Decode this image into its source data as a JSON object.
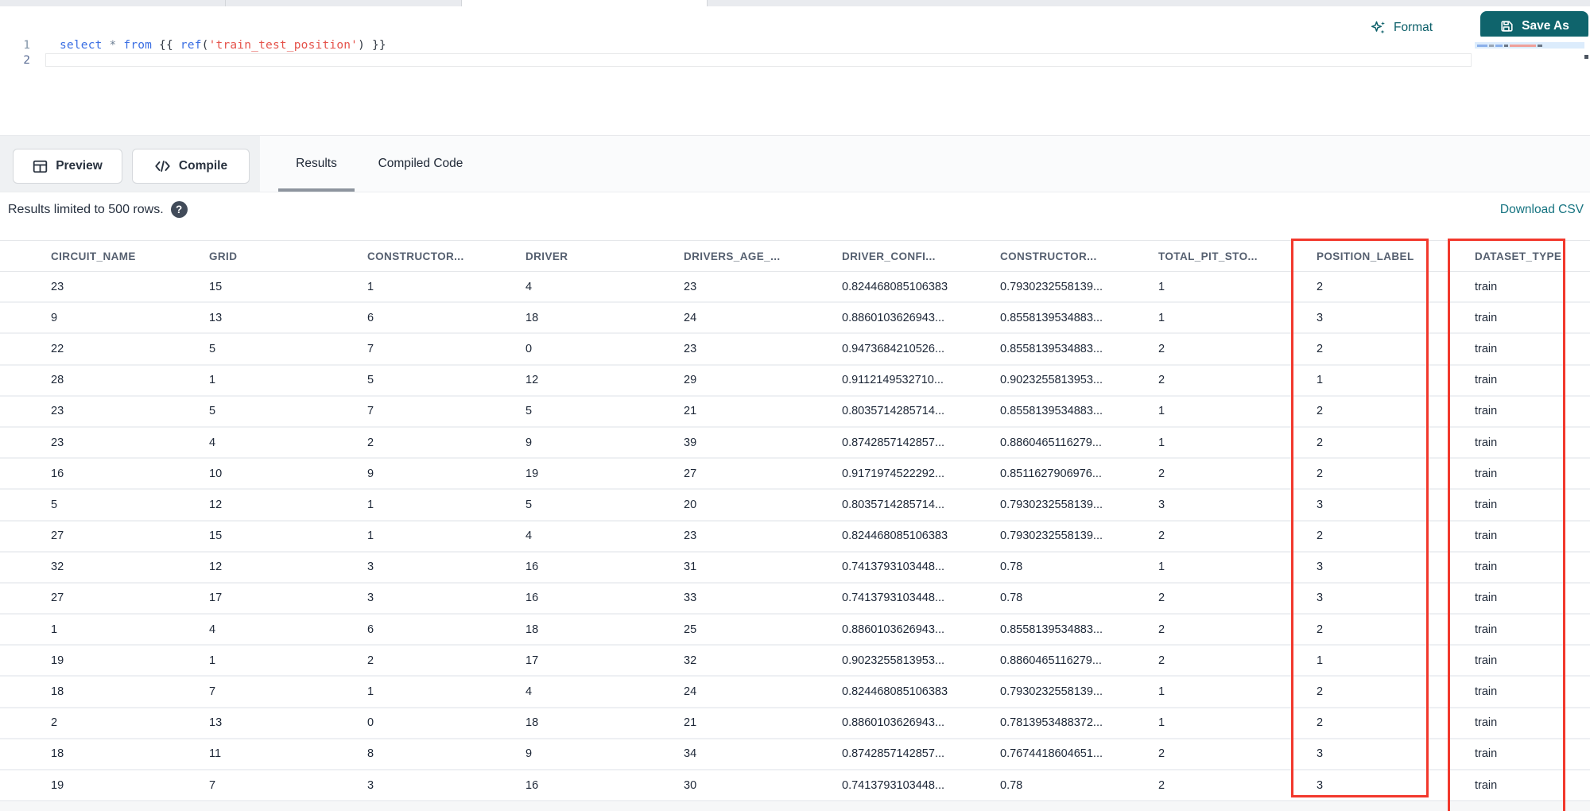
{
  "colors": {
    "accent": "#0f646c",
    "highlight_box": "#f2382c",
    "keyword_blue": "#3b6fe3",
    "string_red": "#e5534b"
  },
  "toolbar": {
    "format_label": "Format",
    "save_as_label": "Save As"
  },
  "editor": {
    "line1_number": "1",
    "line2_number": "2",
    "code_tokens": [
      {
        "text": "select ",
        "color": "#3b6fe3"
      },
      {
        "text": "* ",
        "color": "#6d7f94"
      },
      {
        "text": "from ",
        "color": "#3b6fe3"
      },
      {
        "text": "{{ ",
        "color": "#333a45"
      },
      {
        "text": "ref",
        "color": "#3b6fe3"
      },
      {
        "text": "(",
        "color": "#333a45"
      },
      {
        "text": "'train_test_position'",
        "color": "#e5534b"
      },
      {
        "text": ")",
        "color": "#333a45"
      },
      {
        "text": " }}",
        "color": "#333a45"
      }
    ]
  },
  "actions": {
    "preview_label": "Preview",
    "compile_label": "Compile"
  },
  "tabs": {
    "results": "Results",
    "compiled_code": "Compiled Code"
  },
  "results_bar": {
    "limit_text": "Results limited to 500 rows.",
    "help_icon": "?",
    "download_label": "Download CSV"
  },
  "table": {
    "columns": [
      "CIRCUIT_NAME",
      "GRID",
      "CONSTRUCTOR...",
      "DRIVER",
      "DRIVERS_AGE_...",
      "DRIVER_CONFI...",
      "CONSTRUCTOR...",
      "TOTAL_PIT_STO...",
      "POSITION_LABEL",
      "DATASET_TYPE"
    ],
    "rows": [
      [
        "23",
        "15",
        "1",
        "4",
        "23",
        "0.824468085106383",
        "0.7930232558139...",
        "1",
        "2",
        "train"
      ],
      [
        "9",
        "13",
        "6",
        "18",
        "24",
        "0.8860103626943...",
        "0.8558139534883...",
        "1",
        "3",
        "train"
      ],
      [
        "22",
        "5",
        "7",
        "0",
        "23",
        "0.9473684210526...",
        "0.8558139534883...",
        "2",
        "2",
        "train"
      ],
      [
        "28",
        "1",
        "5",
        "12",
        "29",
        "0.9112149532710...",
        "0.9023255813953...",
        "2",
        "1",
        "train"
      ],
      [
        "23",
        "5",
        "7",
        "5",
        "21",
        "0.8035714285714...",
        "0.8558139534883...",
        "1",
        "2",
        "train"
      ],
      [
        "23",
        "4",
        "2",
        "9",
        "39",
        "0.8742857142857...",
        "0.8860465116279...",
        "1",
        "2",
        "train"
      ],
      [
        "16",
        "10",
        "9",
        "19",
        "27",
        "0.9171974522292...",
        "0.8511627906976...",
        "2",
        "2",
        "train"
      ],
      [
        "5",
        "12",
        "1",
        "5",
        "20",
        "0.8035714285714...",
        "0.7930232558139...",
        "3",
        "3",
        "train"
      ],
      [
        "27",
        "15",
        "1",
        "4",
        "23",
        "0.824468085106383",
        "0.7930232558139...",
        "2",
        "2",
        "train"
      ],
      [
        "32",
        "12",
        "3",
        "16",
        "31",
        "0.7413793103448...",
        "0.78",
        "1",
        "3",
        "train"
      ],
      [
        "27",
        "17",
        "3",
        "16",
        "33",
        "0.7413793103448...",
        "0.78",
        "2",
        "3",
        "train"
      ],
      [
        "1",
        "4",
        "6",
        "18",
        "25",
        "0.8860103626943...",
        "0.8558139534883...",
        "2",
        "2",
        "train"
      ],
      [
        "19",
        "1",
        "2",
        "17",
        "32",
        "0.9023255813953...",
        "0.8860465116279...",
        "2",
        "1",
        "train"
      ],
      [
        "18",
        "7",
        "1",
        "4",
        "24",
        "0.824468085106383",
        "0.7930232558139...",
        "1",
        "2",
        "train"
      ],
      [
        "2",
        "13",
        "0",
        "18",
        "21",
        "0.8860103626943...",
        "0.7813953488372...",
        "1",
        "2",
        "train"
      ],
      [
        "18",
        "11",
        "8",
        "9",
        "34",
        "0.8742857142857...",
        "0.7674418604651...",
        "2",
        "3",
        "train"
      ],
      [
        "19",
        "7",
        "3",
        "16",
        "30",
        "0.7413793103448...",
        "0.78",
        "2",
        "3",
        "train"
      ]
    ]
  }
}
